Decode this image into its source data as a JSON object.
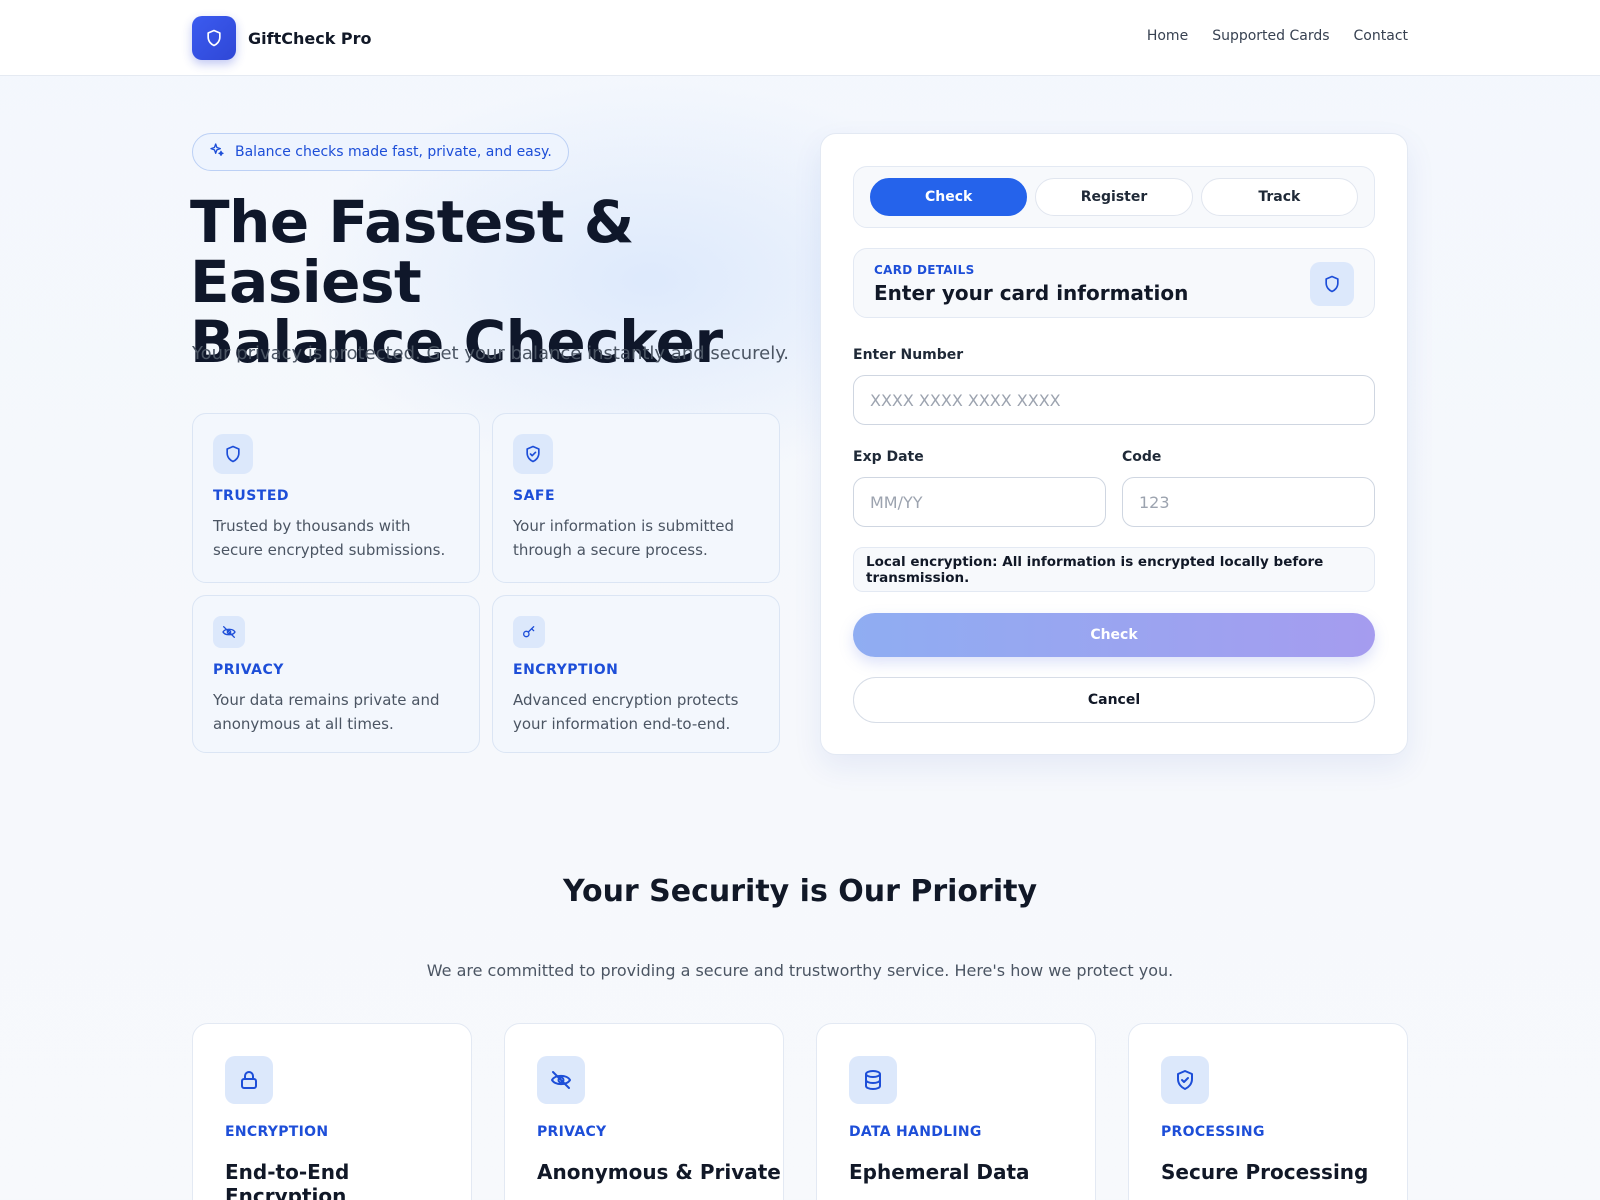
{
  "header": {
    "brand_name": "GiftCheck Pro",
    "brand_icon": "shield-icon",
    "nav": [
      {
        "label": "Home"
      },
      {
        "label": "Supported Cards"
      },
      {
        "label": "Contact"
      }
    ]
  },
  "hero": {
    "pill_text": "Balance checks made fast, private, and easy.",
    "title_line1": "The Fastest & Easiest",
    "title_line2": "Balance Checker",
    "subtitle": "Your privacy is protected. Get your balance instantly and securely.",
    "features": [
      {
        "icon": "shield-icon",
        "title": "TRUSTED",
        "desc": "Trusted by thousands with secure encrypted submissions."
      },
      {
        "icon": "shield-check-icon",
        "title": "SAFE",
        "desc": "Your information is submitted through a secure process."
      },
      {
        "icon": "eye-off-icon",
        "title": "PRIVACY",
        "desc": "Your data remains private and anonymous at all times."
      },
      {
        "icon": "key-icon",
        "title": "ENCRYPTION",
        "desc": "Advanced encryption protects your information end-to-end."
      }
    ]
  },
  "form": {
    "tabs": [
      {
        "label": "Check",
        "active": true
      },
      {
        "label": "Register",
        "active": false
      },
      {
        "label": "Track",
        "active": false
      }
    ],
    "details_label": "CARD DETAILS",
    "details_title": "Enter your card information",
    "number_label": "Enter Number",
    "number_placeholder": "XXXX XXXX XXXX XXXX",
    "exp_label": "Exp Date",
    "exp_placeholder": "MM/YY",
    "code_label": "Code",
    "code_placeholder": "123",
    "note": "Local encryption: All information is encrypted locally before transmission.",
    "check_label": "Check",
    "cancel_label": "Cancel"
  },
  "security": {
    "title": "Your Security is Our Priority",
    "subtitle": "We are committed to providing a secure and trustworthy service. Here's how we protect you.",
    "cards": [
      {
        "icon": "lock-icon",
        "label": "ENCRYPTION",
        "title": "End-to-End Encryption"
      },
      {
        "icon": "eye-off-icon",
        "label": "PRIVACY",
        "title": "Anonymous & Private"
      },
      {
        "icon": "database-icon",
        "label": "DATA HANDLING",
        "title": "Ephemeral Data"
      },
      {
        "icon": "shield-check-icon",
        "label": "PROCESSING",
        "title": "Secure Processing"
      }
    ]
  },
  "colors": {
    "accent": "#2563eb",
    "accent_text": "#1d4ed8",
    "icon_bg": "#dce8fb"
  }
}
